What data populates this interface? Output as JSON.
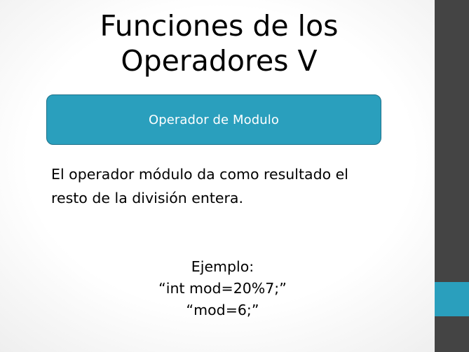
{
  "slide": {
    "title_line1": "Funciones de los",
    "title_line2": "Operadores V",
    "callout": {
      "label": "Operador de Modulo"
    },
    "description_line1": "El operador módulo da como resultado el",
    "description_line2": "resto de la división entera.",
    "example": {
      "heading": "Ejemplo:",
      "line1": "“int mod=20%7;”",
      "line2": "“mod=6;”"
    }
  },
  "colors": {
    "accent": "#2a9fbd",
    "side_strip": "#444444",
    "text": "#000000"
  }
}
